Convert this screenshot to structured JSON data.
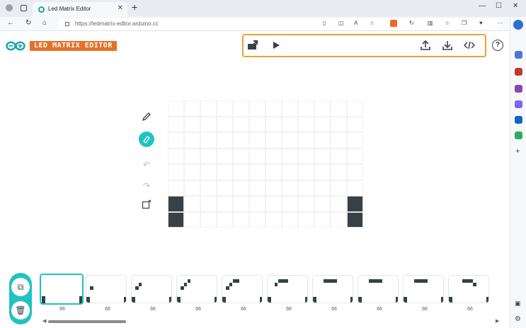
{
  "browser": {
    "tab_title": "Led Matrix Editor",
    "tab_close": "✕",
    "new_tab": "+",
    "url": "https://ledmatrix-editor.arduino.cc",
    "win_minimize": "—",
    "win_maximize": "☐",
    "win_close": "✕"
  },
  "app": {
    "logo_text": "LED MATRIX EDITOR",
    "help_label": "?",
    "brand_color": "#e47128",
    "accent_color": "#1fc3c0",
    "toolbar_border_color": "#f0a030"
  },
  "toolbar": {
    "icons": [
      "import-icon",
      "play-icon",
      "upload-icon",
      "download-icon",
      "code-icon"
    ]
  },
  "side_tools": [
    "pen-icon",
    "eraser-icon",
    "undo-icon",
    "redo-icon",
    "clear-icon"
  ],
  "matrix": {
    "cols": 12,
    "rows": 8,
    "lit": [
      [
        0,
        6
      ],
      [
        0,
        7
      ],
      [
        11,
        6
      ],
      [
        11,
        7
      ]
    ]
  },
  "frames": [
    {
      "label": "66",
      "selected": true
    },
    {
      "label": "66"
    },
    {
      "label": "66"
    },
    {
      "label": "66"
    },
    {
      "label": "66"
    },
    {
      "label": "66"
    },
    {
      "label": "66"
    },
    {
      "label": "66"
    },
    {
      "label": "66"
    },
    {
      "label": "66"
    }
  ],
  "actions": [
    "copy-frame-icon",
    "delete-frame-icon"
  ]
}
